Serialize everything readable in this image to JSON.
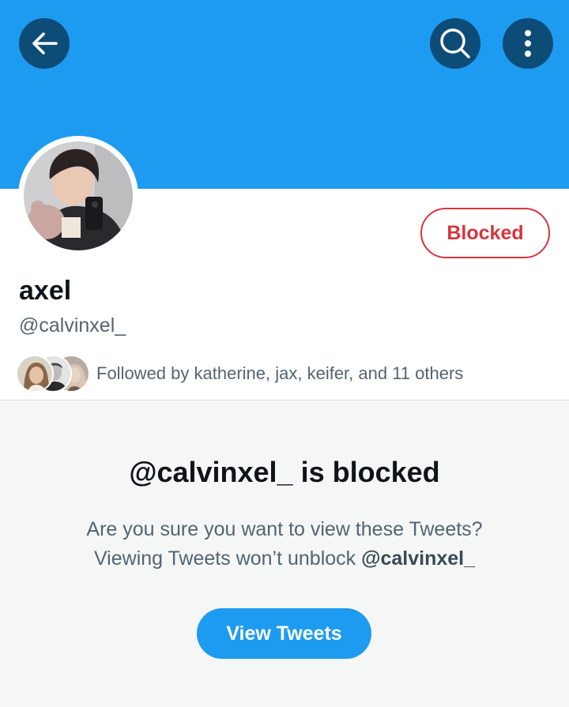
{
  "header": {
    "back_icon": "arrow-left-icon",
    "search_icon": "search-icon",
    "more_icon": "more-vertical-icon",
    "banner_color": "#1d9bf0"
  },
  "profile": {
    "display_name": "axel",
    "handle": "@calvinxel_",
    "relationship_button": "Blocked",
    "relationship_color": "#d9343d"
  },
  "followers": {
    "text": "Followed by katherine, jax, keifer, and 11 others"
  },
  "blocked_notice": {
    "title": "@calvinxel_ is blocked",
    "line1": "Are you sure you want to view these Tweets?",
    "line2_prefix": "Viewing Tweets won’t unblock ",
    "line2_handle": "@calvinxel_",
    "button": "View Tweets",
    "button_color": "#1d9bf0"
  }
}
